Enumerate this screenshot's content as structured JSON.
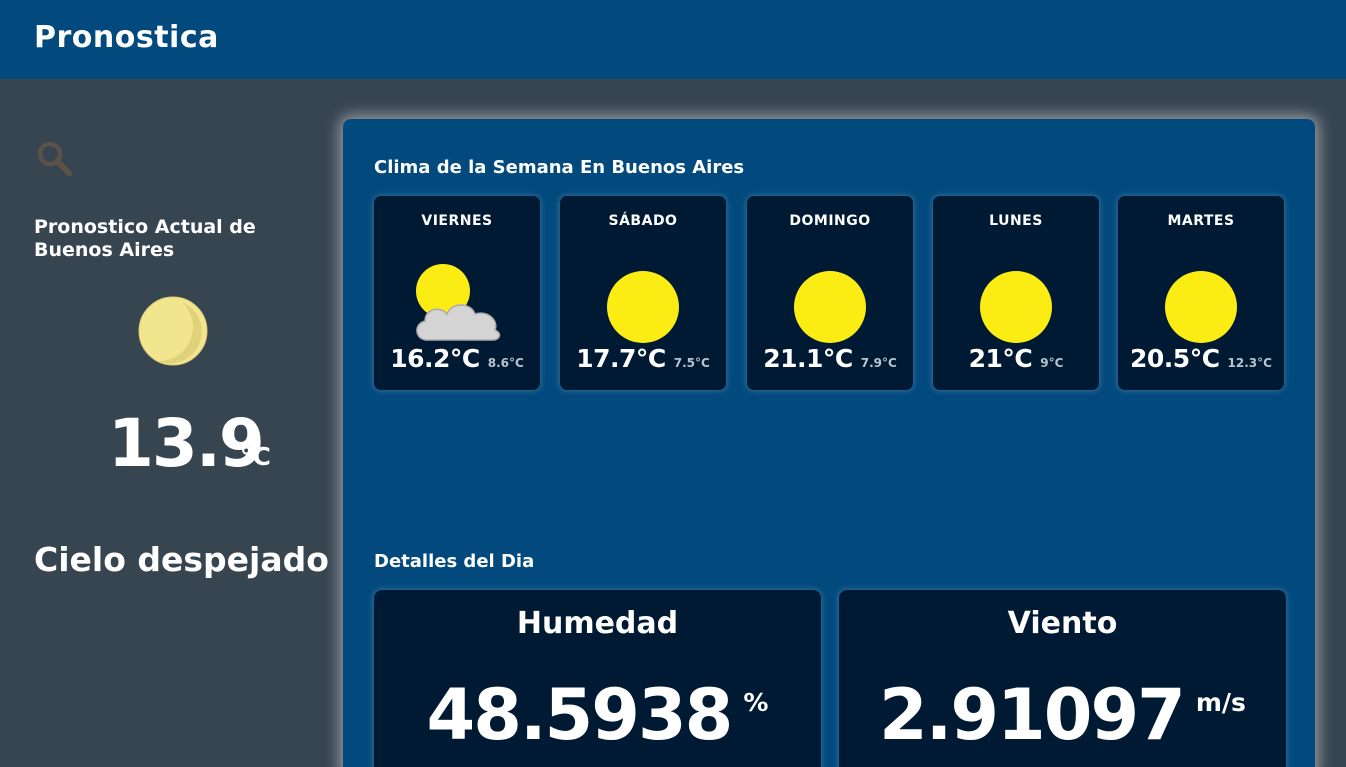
{
  "app": {
    "title": "Pronostica"
  },
  "colors": {
    "header": "#024a7e",
    "background": "#374551",
    "card": "#001a33",
    "sun": "#fbed14"
  },
  "search": {
    "icon": "search-icon"
  },
  "current": {
    "title": "Pronostico Actual de Buenos Aires",
    "icon": "moon-icon",
    "temperature": "13.9",
    "unit": "°C",
    "description": "Cielo despejado"
  },
  "week": {
    "title": "Clima de la Semana En Buenos Aires",
    "days": [
      {
        "name": "VIERNES",
        "icon": "partly-cloudy-icon",
        "max": "16.2°C",
        "min": "8.6°C"
      },
      {
        "name": "SÁBADO",
        "icon": "sun-icon",
        "max": "17.7°C",
        "min": "7.5°C"
      },
      {
        "name": "DOMINGO",
        "icon": "sun-icon",
        "max": "21.1°C",
        "min": "7.9°C"
      },
      {
        "name": "LUNES",
        "icon": "sun-icon",
        "max": "21°C",
        "min": "9°C"
      },
      {
        "name": "MARTES",
        "icon": "sun-icon",
        "max": "20.5°C",
        "min": "12.3°C"
      }
    ]
  },
  "details": {
    "title": "Detalles del Dia",
    "humidity": {
      "label": "Humedad",
      "value": "48.5938",
      "unit": "%"
    },
    "wind": {
      "label": "Viento",
      "value": "2.91097",
      "unit": "m/s"
    }
  }
}
